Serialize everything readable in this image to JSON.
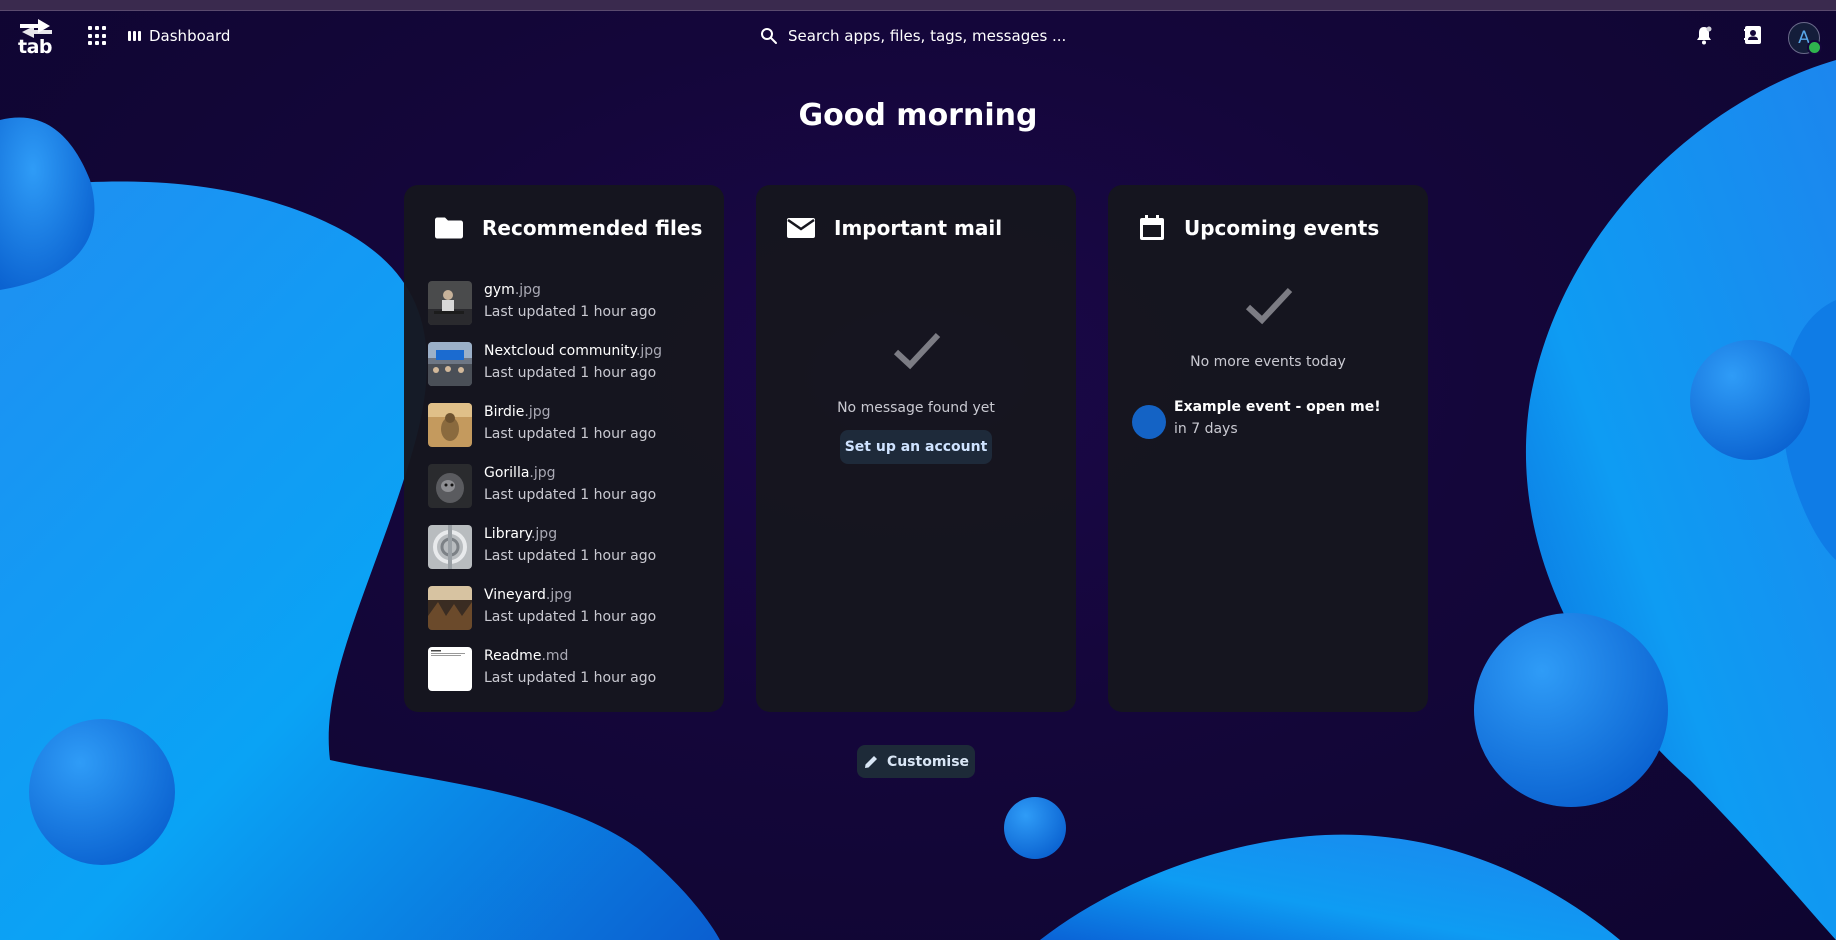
{
  "header": {
    "logo_text": "tab",
    "app_label": "Dashboard",
    "search_placeholder": "Search apps, files, tags, messages ...",
    "avatar_letter": "A"
  },
  "greeting": "Good morning",
  "panels": {
    "files": {
      "title": "Recommended files",
      "items": [
        {
          "name": "gym",
          "ext": ".jpg",
          "sub": "Last updated 1 hour ago"
        },
        {
          "name": "Nextcloud community",
          "ext": ".jpg",
          "sub": "Last updated 1 hour ago"
        },
        {
          "name": "Birdie",
          "ext": ".jpg",
          "sub": "Last updated 1 hour ago"
        },
        {
          "name": "Gorilla",
          "ext": ".jpg",
          "sub": "Last updated 1 hour ago"
        },
        {
          "name": "Library",
          "ext": ".jpg",
          "sub": "Last updated 1 hour ago"
        },
        {
          "name": "Vineyard",
          "ext": ".jpg",
          "sub": "Last updated 1 hour ago"
        },
        {
          "name": "Readme",
          "ext": ".md",
          "sub": "Last updated 1 hour ago"
        }
      ]
    },
    "mail": {
      "title": "Important mail",
      "empty_text": "No message found yet",
      "button": "Set up an account"
    },
    "events": {
      "title": "Upcoming events",
      "empty_text": "No more events today",
      "event_title": "Example event - open me!",
      "event_sub": "in 7 days"
    }
  },
  "customise_label": "Customise",
  "colors": {
    "background": "#14063a",
    "blob": "#1a8ef0",
    "panel": "#16161e",
    "accent": "#1463c5",
    "status": "#2fb34e"
  }
}
